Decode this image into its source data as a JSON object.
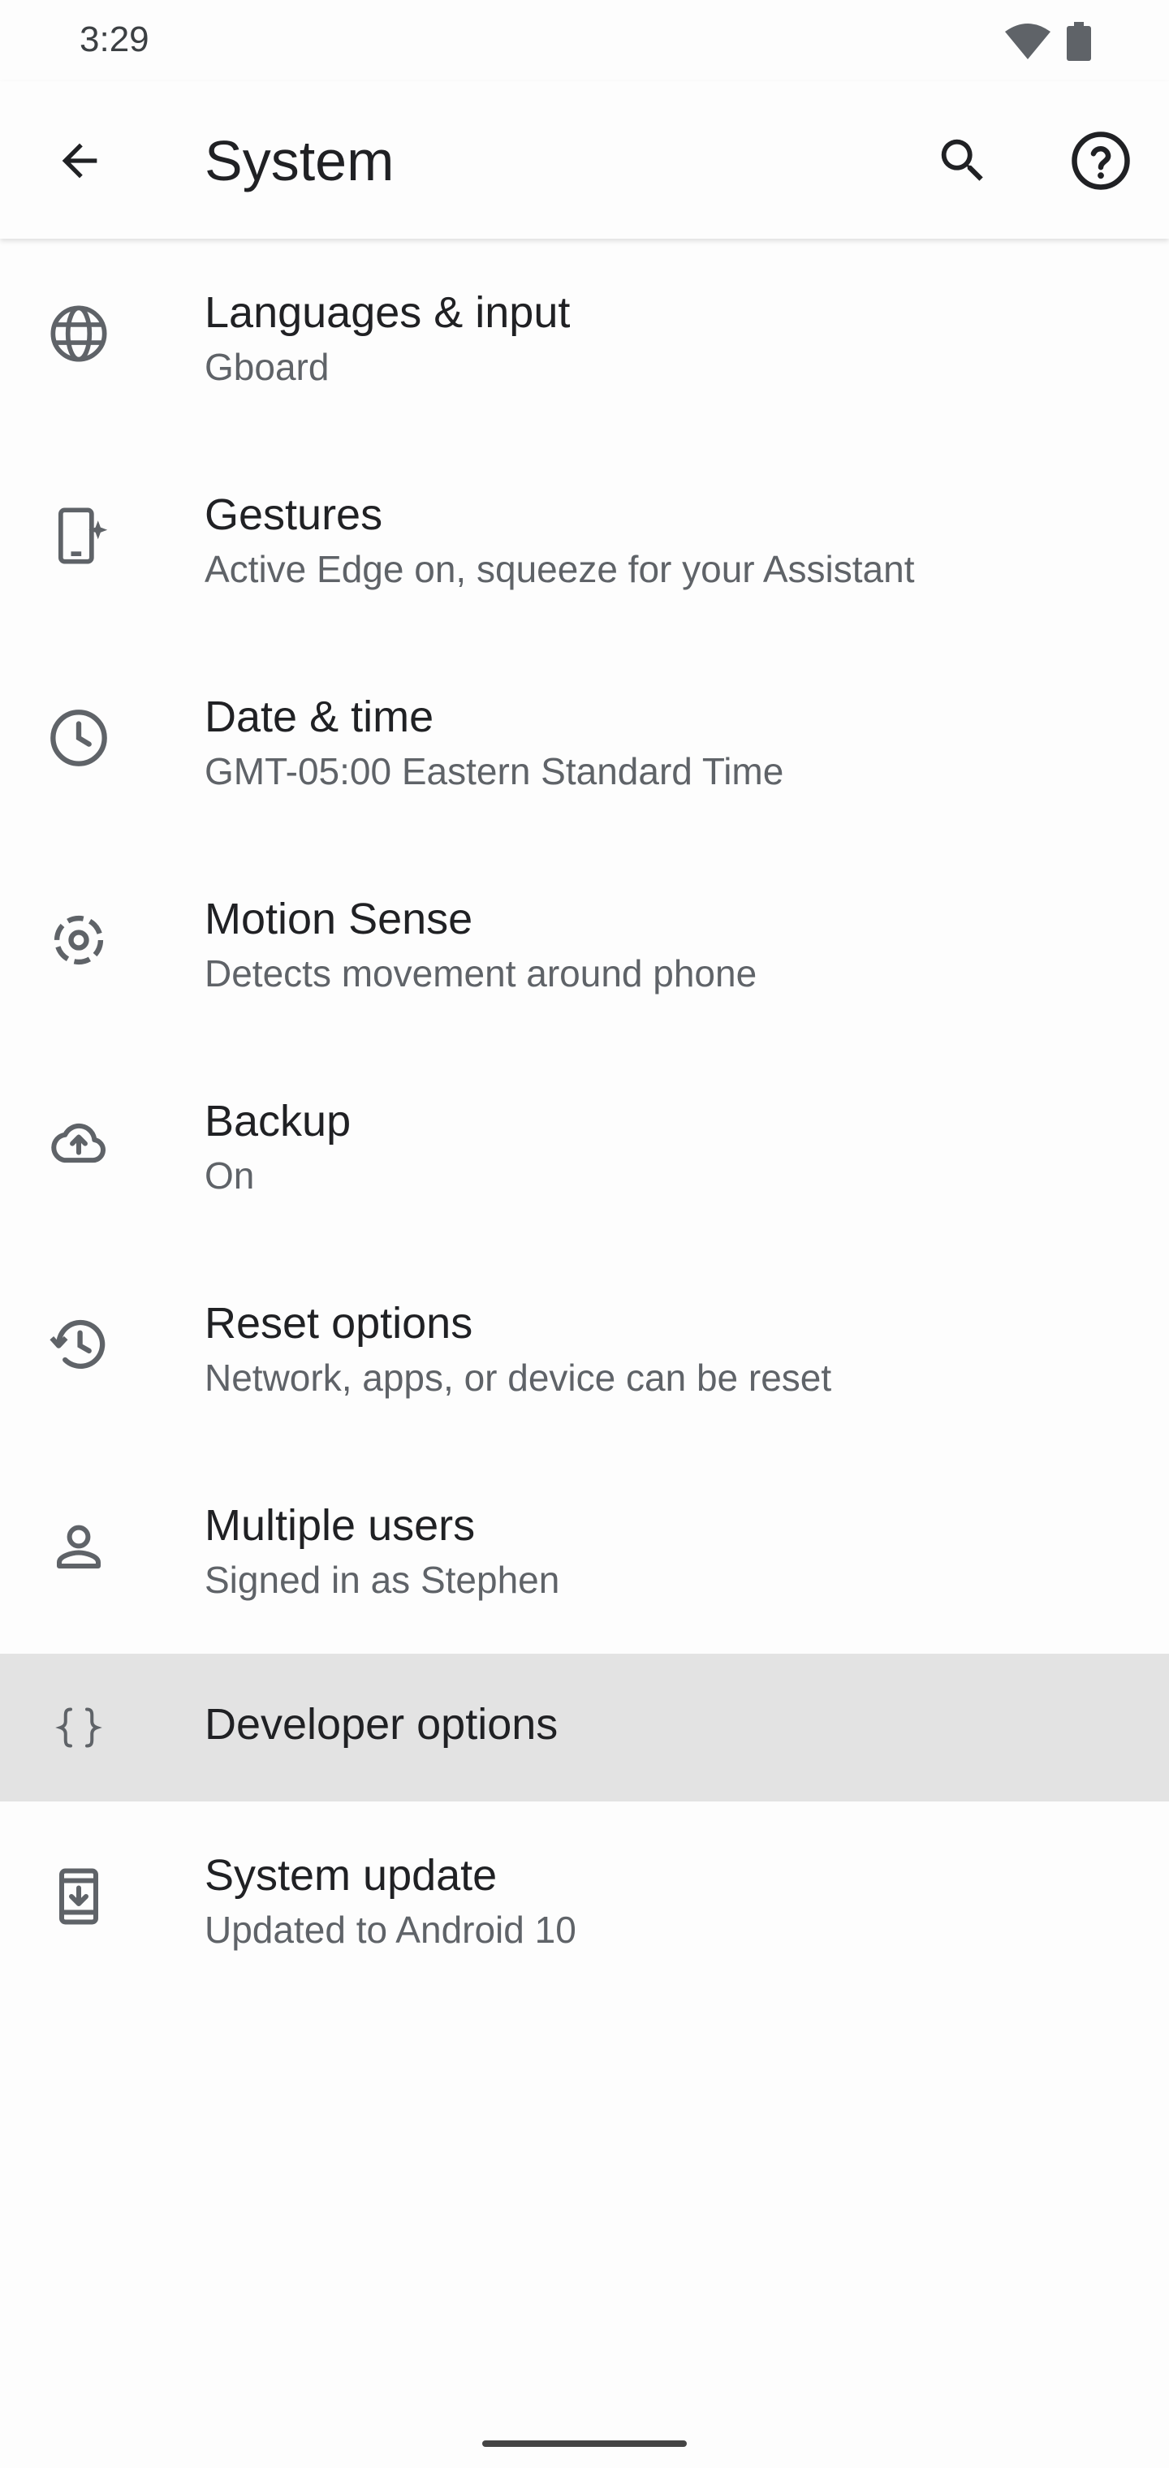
{
  "status_bar": {
    "time": "3:29"
  },
  "app_bar": {
    "title": "System"
  },
  "items": [
    {
      "label": "Languages & input",
      "summary": "Gboard",
      "icon": "globe-icon"
    },
    {
      "label": "Gestures",
      "summary": "Active Edge on, squeeze for your Assistant",
      "icon": "gestures-icon"
    },
    {
      "label": "Date & time",
      "summary": "GMT-05:00 Eastern Standard Time",
      "icon": "clock-icon"
    },
    {
      "label": "Motion Sense",
      "summary": "Detects movement around phone",
      "icon": "motion-sense-icon"
    },
    {
      "label": "Backup",
      "summary": "On",
      "icon": "cloud-upload-icon"
    },
    {
      "label": "Reset options",
      "summary": "Network, apps, or device can be reset",
      "icon": "history-icon"
    },
    {
      "label": "Multiple users",
      "summary": "Signed in as Stephen",
      "icon": "person-icon"
    },
    {
      "label": "Developer options",
      "icon": "braces-icon"
    },
    {
      "label": "System update",
      "summary": "Updated to Android 10",
      "icon": "system-update-icon"
    }
  ],
  "colors": {
    "background": "#fdfdfd",
    "highlight": "#e3e3e3",
    "icon": "#5f6368",
    "text_primary": "#202124",
    "text_secondary": "#5f6368"
  }
}
